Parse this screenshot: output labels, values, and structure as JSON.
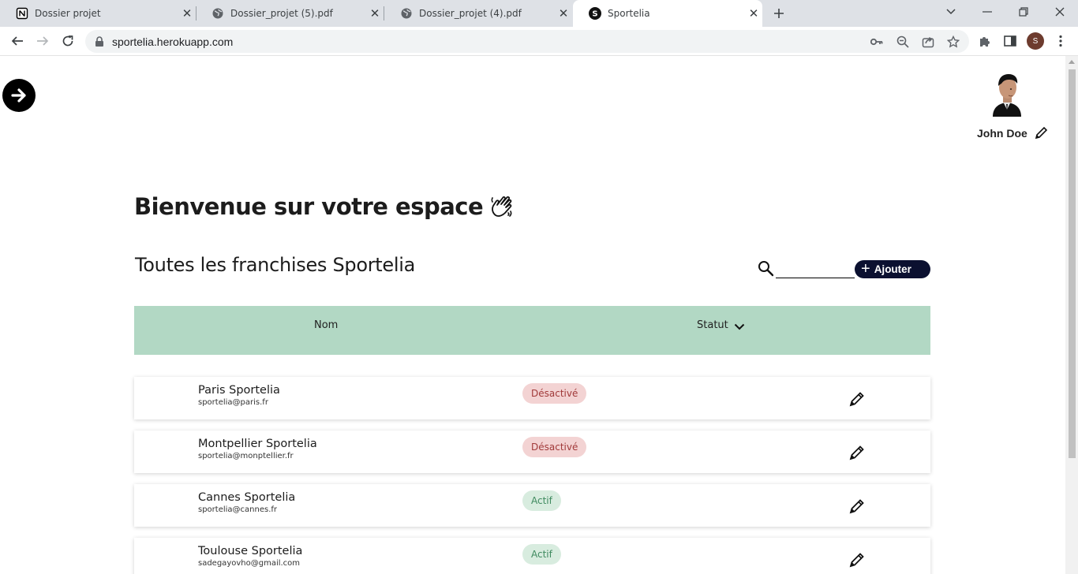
{
  "browser": {
    "tabs": [
      {
        "title": "Dossier projet",
        "icon": "notion-icon"
      },
      {
        "title": "Dossier_projet (5).pdf",
        "icon": "globe-icon"
      },
      {
        "title": "Dossier_projet (4).pdf",
        "icon": "globe-icon"
      },
      {
        "title": "Sportelia",
        "icon": "sportelia-favicon"
      }
    ],
    "active_tab": 3,
    "url": "sportelia.herokuapp.com",
    "profile_initial": "S"
  },
  "user": {
    "name": "John Doe"
  },
  "header": {
    "welcome": "Bienvenue sur votre espace",
    "section_title": "Toutes les franchises Sportelia"
  },
  "actions": {
    "add_label": "Ajouter",
    "search_placeholder": ""
  },
  "table": {
    "columns": {
      "nom": "Nom",
      "statut": "Statut"
    },
    "rows": [
      {
        "name": "Paris Sportelia",
        "email": "sportelia@paris.fr",
        "status": "Désactivé",
        "active": false
      },
      {
        "name": "Montpellier Sportelia",
        "email": "sportelia@monptellier.fr",
        "status": "Désactivé",
        "active": false
      },
      {
        "name": "Cannes Sportelia",
        "email": "sportelia@cannes.fr",
        "status": "Actif",
        "active": true
      },
      {
        "name": "Toulouse Sportelia",
        "email": "sadegayovho@gmail.com",
        "status": "Actif",
        "active": true
      }
    ]
  },
  "colors": {
    "header_bg": "#b2d8c4",
    "add_button": "#0b1030",
    "inactive_badge_bg": "#f3d3d3",
    "inactive_badge_text": "#a13a3a",
    "active_badge_bg": "#d8ecdf",
    "active_badge_text": "#3f8a5f"
  }
}
